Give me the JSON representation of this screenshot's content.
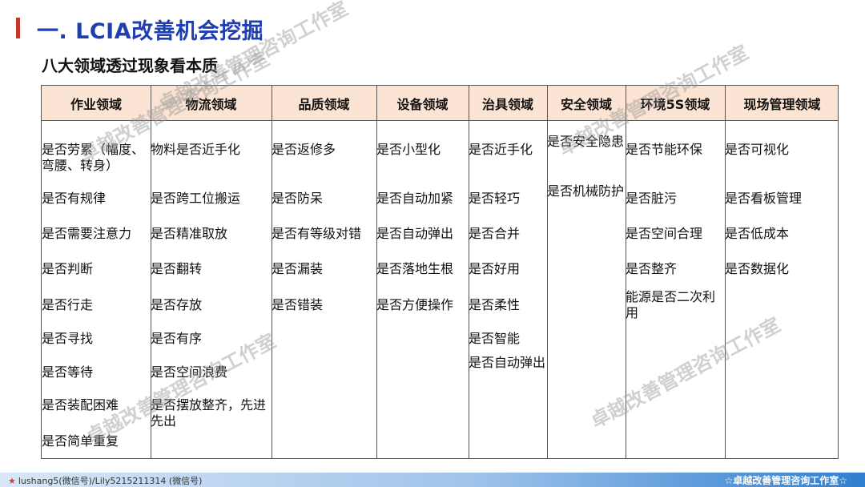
{
  "header": {
    "title": "一. LCIA改善机会挖掘",
    "subtitle": "八大领域透过现象看本质"
  },
  "table": {
    "columns": [
      {
        "name": "作业领域",
        "items": [
          "是否劳累（幅度、弯腰、转身）",
          "是否有规律",
          "是否需要注意力",
          "是否判断",
          "是否行走",
          "是否寻找",
          "是否等待",
          "是否装配困难",
          "是否简单重复"
        ]
      },
      {
        "name": "物流领域",
        "items": [
          "物料是否近手化",
          "是否跨工位搬运",
          "是否精准取放",
          "是否翻转",
          "是否存放",
          "是否有序",
          "是否空间浪费",
          "是否摆放整齐，先进先出"
        ]
      },
      {
        "name": "品质领域",
        "items": [
          "是否返修多",
          "是否防呆",
          "是否有等级对错",
          "是否漏装",
          "是否错装"
        ]
      },
      {
        "name": "设备领域",
        "items": [
          "是否小型化",
          "是否自动加紧",
          "是否自动弹出",
          "是否落地生根",
          "是否方便操作"
        ]
      },
      {
        "name": "治具领域",
        "items": [
          "是否近手化",
          "是否轻巧",
          "是否合并",
          "是否好用",
          "是否柔性",
          "是否智能",
          "是否自动弹出"
        ]
      },
      {
        "name": "安全领域",
        "items": [
          "是否安全隐患",
          "是否机械防护"
        ]
      },
      {
        "name": "环境5S领域",
        "items": [
          "是否节能环保",
          "是否脏污",
          "是否空间合理",
          "是否整齐",
          "能源是否二次利用"
        ]
      },
      {
        "name": "现场管理领域",
        "items": [
          "是否可视化",
          "是否看板管理",
          "是否低成本",
          "是否数据化"
        ]
      }
    ]
  },
  "watermark": "卓越改善管理咨询工作室",
  "footer": {
    "left_text": "lushang5(微信号)/Lily5215211314 (微信号)",
    "right_text": "☆卓越改善管理咨询工作室☆"
  },
  "colors": {
    "title": "#1f3fb0",
    "accent_bar": "#c0392b",
    "header_fill": "#fbe4d4",
    "footer_gradient_end": "#2f7fd0"
  }
}
